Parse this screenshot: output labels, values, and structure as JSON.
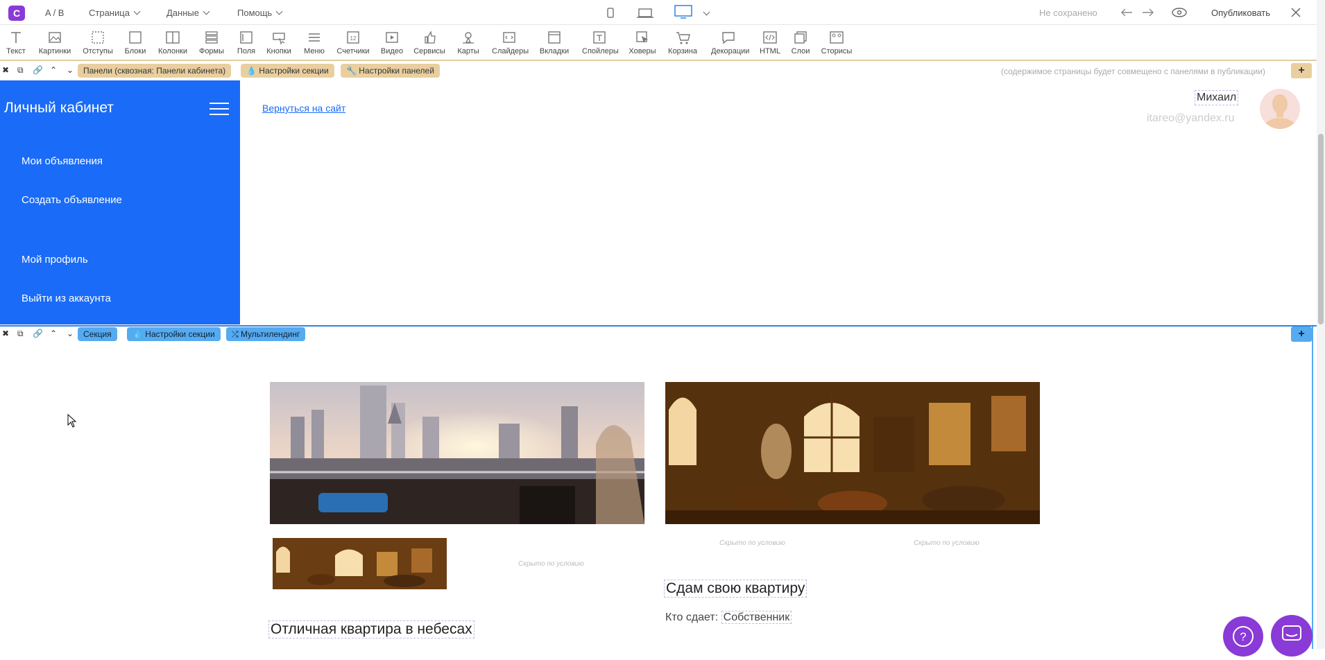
{
  "topbar": {
    "ab": "A / B",
    "menus": [
      "Страница",
      "Данные",
      "Помощь"
    ],
    "status": "Не сохранено",
    "publish": "Опубликовать"
  },
  "toolbar": {
    "tools": [
      "Текст",
      "Картинки",
      "Отступы",
      "Блоки",
      "Колонки",
      "Формы",
      "Поля",
      "Кнопки",
      "Меню",
      "Счетчики",
      "Видео",
      "Сервисы",
      "Карты",
      "Слайдеры",
      "Вкладки",
      "Спойлеры",
      "Ховеры",
      "Корзина",
      "Декорации",
      "HTML",
      "Слои",
      "Сторисы"
    ]
  },
  "panelbar": {
    "label": "Панели (сквозная: Панели кабинета)",
    "section_settings": "Настройки секции",
    "panel_settings": "Настройки панелей",
    "note": "(содержимое страницы будет совмещено с панелями в публикации)"
  },
  "sidebar": {
    "title": "Личный кабинет",
    "items": [
      "Мои объявления",
      "Создать объявление",
      "Мой профиль",
      "Выйти из аккаунта"
    ]
  },
  "header": {
    "back_link": "Вернуться на сайт",
    "user_name": "Михаил",
    "user_email": "itareo@yandex.ru"
  },
  "sectionbar": {
    "label": "Секция",
    "section_settings": "Настройки секции",
    "multilanding": "Мультилендинг"
  },
  "content": {
    "hidden_note": "Скрыто по условию",
    "card1_title": "Отличная квартира в небесах",
    "card2_title": "Сдам свою квартиру",
    "who_label": "Кто сдает:",
    "who_value": "Собственник"
  },
  "colors": {
    "brand": "#1a6bf7",
    "accent": "#8a3ad6",
    "panel_chip": "#e9cf9f",
    "section_chip": "#55aaf0"
  }
}
